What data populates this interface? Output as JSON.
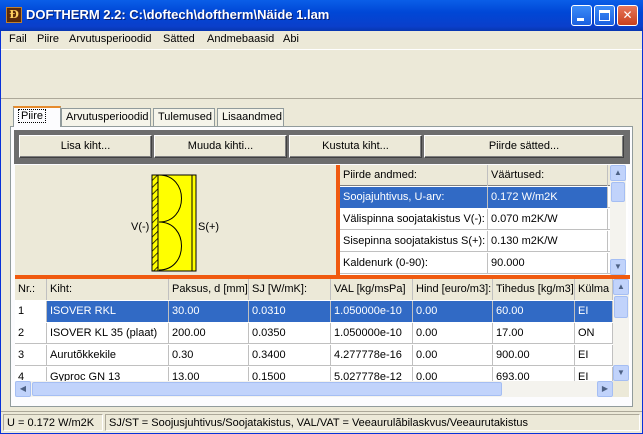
{
  "window": {
    "title": "DOFTHERM 2.2: C:\\doftech\\doftherm\\Näide 1.lam"
  },
  "menu": {
    "items": [
      "Fail",
      "Piire",
      "Arvutusperioodid",
      "Sätted",
      "Andmebaasid",
      "Abi"
    ]
  },
  "tabs": [
    "Piire",
    "Arvutusperioodid",
    "Tulemused",
    "Lisaandmed"
  ],
  "buttons": {
    "add": "Lisa kiht...",
    "edit": "Muuda kihti...",
    "delete": "Kustuta kiht...",
    "settings": "Piirde sätted..."
  },
  "diagram": {
    "left_label": "V(-)",
    "right_label": "S(+)"
  },
  "props": {
    "headers": [
      "Piirde andmed:",
      "Väärtused:"
    ],
    "rows": [
      [
        "Soojajuhtivus, U-arv:",
        "0.172 W/m2K"
      ],
      [
        "Välispinna soojatakistus V(-):",
        "0.070 m2K/W"
      ],
      [
        "Sisepinna soojatakistus S(+):",
        "0.130 m2K/W"
      ],
      [
        "Kaldenurk (0-90):",
        "90.000"
      ]
    ]
  },
  "layers": {
    "headers": [
      "Nr.:",
      "Kiht:",
      "Paksus, d [mm]:",
      "SJ [W/mK]:",
      "VAL [kg/msPa]",
      "Hind [euro/m3]:",
      "Tihedus [kg/m3]:",
      "Külma"
    ],
    "rows": [
      [
        "1",
        "ISOVER RKL",
        "30.00",
        "0.0310",
        "1.050000e-10",
        "0.00",
        "60.00",
        "EI"
      ],
      [
        "2",
        "ISOVER KL 35 (plaat)",
        "200.00",
        "0.0350",
        "1.050000e-10",
        "0.00",
        "17.00",
        "ON"
      ],
      [
        "3",
        "Aurutõkkekile",
        "0.30",
        "0.3400",
        "4.277778e-16",
        "0.00",
        "900.00",
        "EI"
      ],
      [
        "4",
        "Gyproc GN 13",
        "13.00",
        "0.1500",
        "5.027778e-12",
        "0.00",
        "693.00",
        "EI"
      ]
    ]
  },
  "status": {
    "u_value": "U = 0.172 W/m2K",
    "legend": "SJ/ST = Soojusjuhtivus/Soojatakistus, VAL/VAT = Veeaurulãbilaskvus/Veeaurutakistus"
  }
}
